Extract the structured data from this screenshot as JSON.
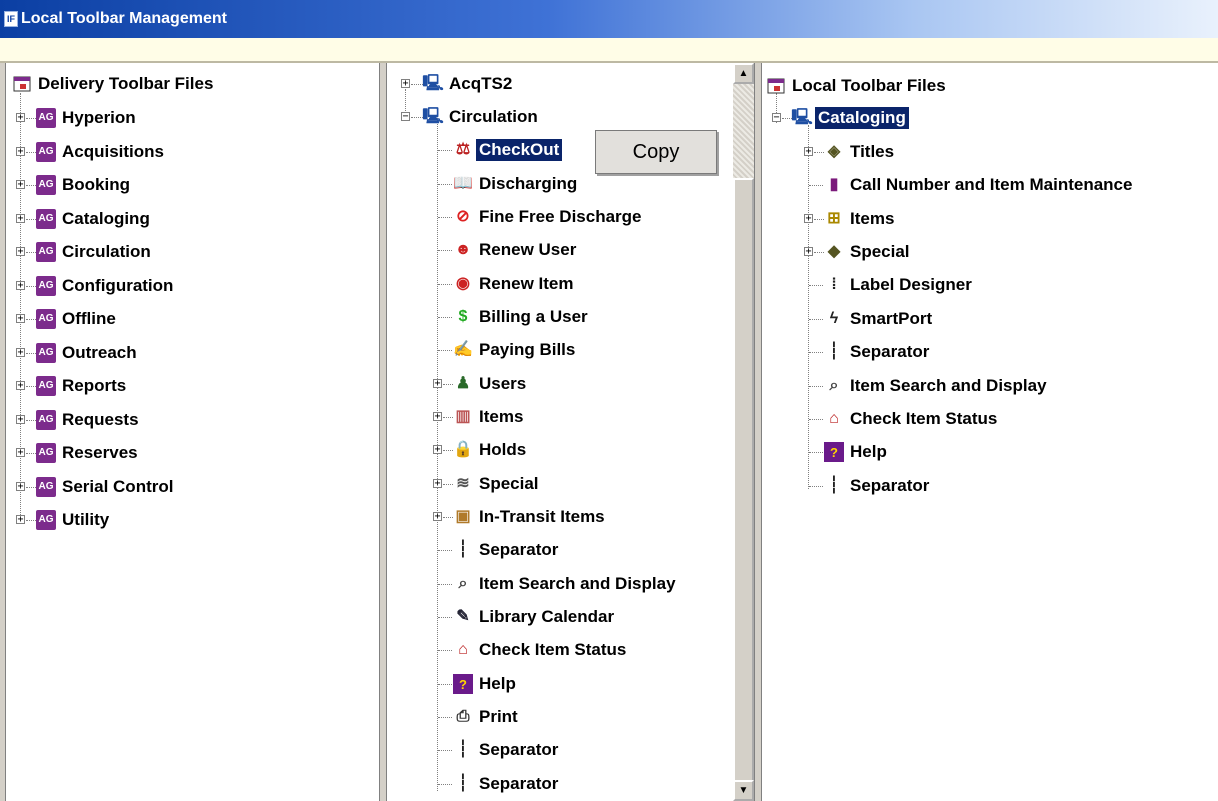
{
  "window": {
    "title": "Local Toolbar Management",
    "app_icon_text": "IF"
  },
  "tooltip": {
    "label": "Copy"
  },
  "left": {
    "root": "Delivery Toolbar Files",
    "items": [
      "Hyperion",
      "Acquisitions",
      "Booking",
      "Cataloging",
      "Circulation",
      "Configuration",
      "Offline",
      "Outreach",
      "Reports",
      "Requests",
      "Reserves",
      "Serial Control",
      "Utility"
    ]
  },
  "middle": {
    "items": [
      {
        "label": "AcqTS2",
        "icon": "computer-icon"
      },
      {
        "label": "Circulation",
        "icon": "computer-icon"
      },
      {
        "label": "CheckOut",
        "icon": "checkout-icon"
      },
      {
        "label": "Discharging",
        "icon": "discharge-icon"
      },
      {
        "label": "Fine Free Discharge",
        "icon": "fine-free-icon"
      },
      {
        "label": "Renew User",
        "icon": "renew-user-icon"
      },
      {
        "label": "Renew Item",
        "icon": "renew-item-icon"
      },
      {
        "label": "Billing a User",
        "icon": "billing-icon"
      },
      {
        "label": "Paying Bills",
        "icon": "paying-icon"
      },
      {
        "label": "Users",
        "icon": "user-icon"
      },
      {
        "label": "Items",
        "icon": "book-icon"
      },
      {
        "label": "Holds",
        "icon": "lock-icon"
      },
      {
        "label": "Special",
        "icon": "tornado-icon"
      },
      {
        "label": "In-Transit Items",
        "icon": "box-icon"
      },
      {
        "label": "Separator",
        "icon": "separator-icon"
      },
      {
        "label": "Item Search and Display",
        "icon": "search-book-icon"
      },
      {
        "label": "Library Calendar",
        "icon": "calendar-icon"
      },
      {
        "label": "Check Item Status",
        "icon": "status-icon"
      },
      {
        "label": "Help",
        "icon": "help-icon"
      },
      {
        "label": "Print",
        "icon": "printer-icon"
      },
      {
        "label": "Separator",
        "icon": "separator-icon"
      },
      {
        "label": "Separator",
        "icon": "separator-icon"
      }
    ]
  },
  "right": {
    "root": "Local Toolbar Files",
    "items": [
      {
        "label": "Cataloging",
        "icon": "computer-icon"
      },
      {
        "label": "Titles",
        "icon": "titles-icon"
      },
      {
        "label": "Call Number and Item Maintenance",
        "icon": "call-number-icon"
      },
      {
        "label": "Items",
        "icon": "hierarchy-icon"
      },
      {
        "label": "Special",
        "icon": "special-book-icon"
      },
      {
        "label": "Label Designer",
        "icon": "label-icon"
      },
      {
        "label": "SmartPort",
        "icon": "lightning-icon"
      },
      {
        "label": "Separator",
        "icon": "separator-icon"
      },
      {
        "label": "Item Search and Display",
        "icon": "search-book-icon"
      },
      {
        "label": "Check Item Status",
        "icon": "status-icon"
      },
      {
        "label": "Help",
        "icon": "help-icon"
      },
      {
        "label": "Separator",
        "icon": "separator-icon"
      }
    ]
  },
  "scrollbar": {
    "up_glyph": "▲",
    "down_glyph": "▼"
  }
}
